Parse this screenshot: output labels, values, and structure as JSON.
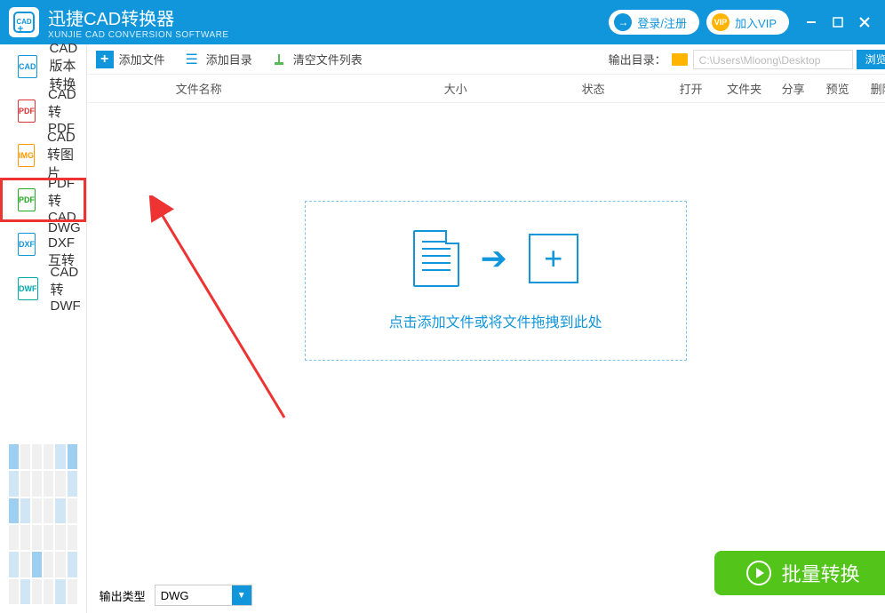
{
  "titlebar": {
    "logo_text": "CAD",
    "app_name": "迅捷CAD转换器",
    "subtitle": "XUNJIE CAD CONVERSION SOFTWARE",
    "login_label": "登录/注册",
    "vip_badge": "VIP",
    "vip_label": "加入VIP"
  },
  "sidebar": {
    "items": [
      {
        "label": "CAD版本转换"
      },
      {
        "label": "CAD转PDF"
      },
      {
        "label": "CAD转图片"
      },
      {
        "label": "PDF转CAD"
      },
      {
        "label": "DWG DXF互转"
      },
      {
        "label": "CAD转DWF"
      }
    ]
  },
  "toolbar": {
    "add_file": "添加文件",
    "add_dir": "添加目录",
    "clear_list": "清空文件列表",
    "outdir_label": "输出目录：",
    "outdir_path": "C:\\Users\\Mloong\\Desktop",
    "browse": "浏览"
  },
  "columns": {
    "name": "文件名称",
    "size": "大小",
    "status": "状态",
    "open": "打开",
    "folder": "文件夹",
    "share": "分享",
    "preview": "预览",
    "delete": "删除"
  },
  "dropzone": {
    "hint": "点击添加文件或将文件拖拽到此处"
  },
  "output": {
    "type_label": "输出类型",
    "type_value": "DWG"
  },
  "convert": {
    "label": "批量转换"
  }
}
